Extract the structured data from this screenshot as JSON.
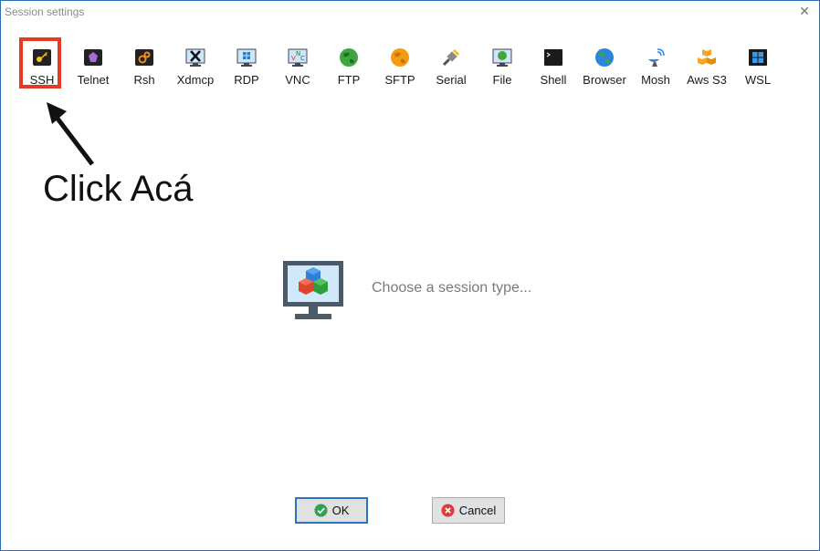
{
  "window": {
    "title": "Session settings"
  },
  "toolbar": {
    "items": [
      {
        "label": "SSH",
        "icon": "key-icon"
      },
      {
        "label": "Telnet",
        "icon": "telnet-icon"
      },
      {
        "label": "Rsh",
        "icon": "rsh-icon"
      },
      {
        "label": "Xdmcp",
        "icon": "xdmcp-icon"
      },
      {
        "label": "RDP",
        "icon": "rdp-icon"
      },
      {
        "label": "VNC",
        "icon": "vnc-icon"
      },
      {
        "label": "FTP",
        "icon": "globe-icon"
      },
      {
        "label": "SFTP",
        "icon": "globe-icon"
      },
      {
        "label": "Serial",
        "icon": "serial-icon"
      },
      {
        "label": "File",
        "icon": "file-icon"
      },
      {
        "label": "Shell",
        "icon": "terminal-icon"
      },
      {
        "label": "Browser",
        "icon": "globe-icon"
      },
      {
        "label": "Mosh",
        "icon": "satellite-icon"
      },
      {
        "label": "Aws S3",
        "icon": "aws-icon"
      },
      {
        "label": "WSL",
        "icon": "windows-icon"
      }
    ]
  },
  "annotation": {
    "text": "Click Acá"
  },
  "main": {
    "prompt": "Choose a session type..."
  },
  "buttons": {
    "ok": "OK",
    "cancel": "Cancel"
  },
  "colors": {
    "highlight": "#e53b23",
    "window_border": "#2a6fb8",
    "ok_border": "#2a74c2"
  }
}
